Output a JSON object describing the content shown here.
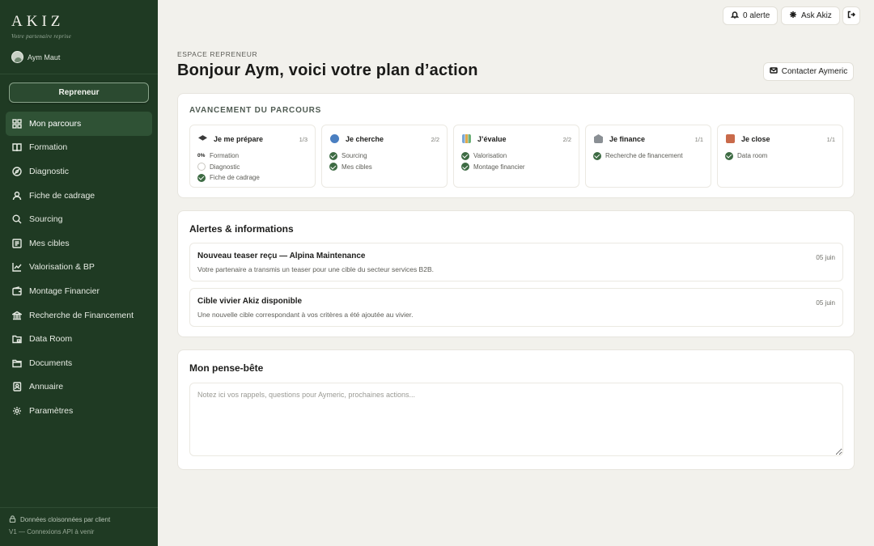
{
  "brand": {
    "logo": "AKIZ",
    "tagline": "Votre partenaire reprise"
  },
  "user": {
    "name": "Aym Maut"
  },
  "role_button": "Repreneur",
  "sidebar": {
    "items": [
      {
        "label": "Mon parcours",
        "icon": "grid-icon",
        "active": true
      },
      {
        "label": "Formation",
        "icon": "book-icon"
      },
      {
        "label": "Diagnostic",
        "icon": "compass-icon"
      },
      {
        "label": "Fiche de cadrage",
        "icon": "user-icon"
      },
      {
        "label": "Sourcing",
        "icon": "search-icon"
      },
      {
        "label": "Mes cibles",
        "icon": "list-icon"
      },
      {
        "label": "Valorisation & BP",
        "icon": "chart-icon"
      },
      {
        "label": "Montage Financier",
        "icon": "wallet-icon"
      },
      {
        "label": "Recherche de Financement",
        "icon": "bank-icon"
      },
      {
        "label": "Data Room",
        "icon": "folder-lock-icon"
      },
      {
        "label": "Documents",
        "icon": "folder-icon"
      },
      {
        "label": "Annuaire",
        "icon": "contacts-icon"
      },
      {
        "label": "Paramètres",
        "icon": "gear-icon"
      }
    ],
    "footer_line1": "Données cloisonnées par client",
    "footer_line2": "V1 — Connexions API à venir"
  },
  "topbar": {
    "alerts_label": "0 alerte",
    "ask_label": "Ask Akiz"
  },
  "header": {
    "eyebrow": "ESPACE REPRENEUR",
    "title": "Bonjour Aym, voici votre plan d’action",
    "contact_label": "Contacter Aymeric"
  },
  "progress": {
    "title": "AVANCEMENT DU PARCOURS",
    "steps": [
      {
        "title": "Je me prépare",
        "count": "1/3",
        "icon": "graduation-cap-icon",
        "color": "#3a3a3a",
        "items": [
          {
            "label": "Formation",
            "state": "percent",
            "percent": "0%"
          },
          {
            "label": "Diagnostic",
            "state": "todo"
          },
          {
            "label": "Fiche de cadrage",
            "state": "done"
          }
        ]
      },
      {
        "title": "Je cherche",
        "count": "2/2",
        "icon": "magnifier-icon",
        "color": "#4a7fc1",
        "items": [
          {
            "label": "Sourcing",
            "state": "done"
          },
          {
            "label": "Mes cibles",
            "state": "done"
          }
        ]
      },
      {
        "title": "J’évalue",
        "count": "2/2",
        "icon": "bar-chart-icon",
        "color": "#7aa7d6",
        "items": [
          {
            "label": "Valorisation",
            "state": "done"
          },
          {
            "label": "Montage financier",
            "state": "done"
          }
        ]
      },
      {
        "title": "Je finance",
        "count": "1/1",
        "icon": "bank-building-icon",
        "color": "#8a8f94",
        "items": [
          {
            "label": "Recherche de financement",
            "state": "done"
          }
        ]
      },
      {
        "title": "Je close",
        "count": "1/1",
        "icon": "briefcase-icon",
        "color": "#c96a4a",
        "items": [
          {
            "label": "Data room",
            "state": "done"
          }
        ]
      }
    ]
  },
  "alerts": {
    "title": "Alertes & informations",
    "items": [
      {
        "title": "Nouveau teaser reçu — Alpina Maintenance",
        "text": "Votre partenaire a transmis un teaser pour une cible du secteur services B2B.",
        "date": "05 juin"
      },
      {
        "title": "Cible vivier Akiz disponible",
        "text": "Une nouvelle cible correspondant à vos critères a été ajoutée au vivier.",
        "date": "05 juin"
      }
    ]
  },
  "notes": {
    "title": "Mon pense-bête",
    "placeholder": "Notez ici vos rappels, questions pour Aymeric, prochaines actions..."
  }
}
